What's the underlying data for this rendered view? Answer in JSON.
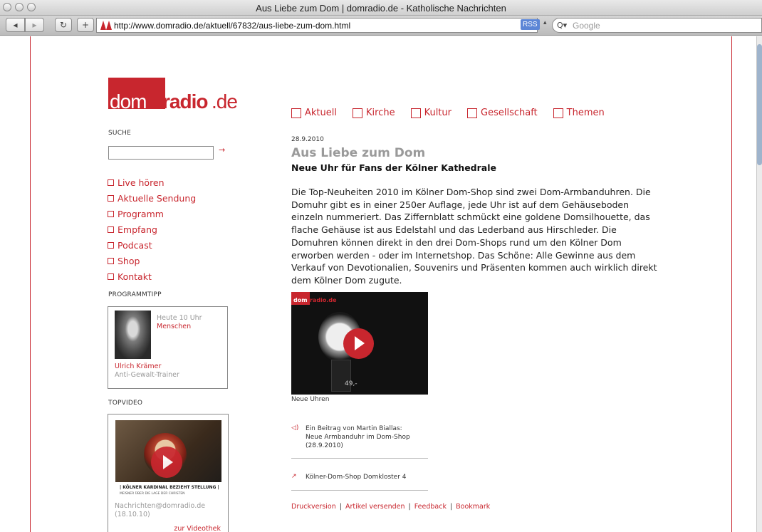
{
  "window": {
    "title": "Aus Liebe zum Dom | domradio.de - Katholische Nachrichten"
  },
  "toolbar": {
    "back_label": "◂",
    "forward_label": "▸",
    "reload_label": "↻",
    "add_label": "+",
    "url": "http://www.domradio.de/aktuell/67832/aus-liebe-zum-dom.html",
    "rss_label": "RSS",
    "search_placeholder": "Google"
  },
  "logo": {
    "part1": "dom",
    "part2": "radio",
    "part3": ".de"
  },
  "topnav": [
    "Aktuell",
    "Kirche",
    "Kultur",
    "Gesellschaft",
    "Themen"
  ],
  "sidebar": {
    "search_label": "SUCHE",
    "search_go": "→",
    "items": [
      "Live hören",
      "Aktuelle Sendung",
      "Programm",
      "Empfang",
      "Podcast",
      "Shop",
      "Kontakt"
    ],
    "programmtipp": {
      "heading": "PROGRAMMTIPP",
      "time": "Heute 10 Uhr",
      "show": "Menschen",
      "name": "Ulrich Krämer",
      "role": "Anti-Gewalt-Trainer"
    },
    "topvideo": {
      "heading": "TOPVIDEO",
      "banner_title": "| KÖLNER KARDINAL BEZIEHT STELLUNG |",
      "banner_sub": "MEISNER ÜBER DIE LAGE DER CHRISTEN",
      "caption1": "Nachrichten@domradio.de",
      "caption2": "(18.10.10)",
      "more_link": "zur Videothek"
    }
  },
  "article": {
    "date": "28.9.2010",
    "title": "Aus Liebe zum Dom",
    "subtitle": "Neue Uhr für Fans der Kölner Kathedrale",
    "body": "Die Top-Neuheiten 2010 im Kölner Dom-Shop sind zwei Dom-Armbanduhren. Die Domuhr gibt es in einer 250er Auflage, jede Uhr ist auf dem Gehäuseboden einzeln nummeriert. Das Ziffernblatt schmückt eine goldene Domsilhouette, das flache Gehäuse ist aus Edelstahl und das Lederband aus Hirschleder. Die Domuhren können direkt in den drei Dom-Shops rund um den Kölner Dom erworben werden - oder im Internetshop. Das Schöne: Alle Gewinne aus dem Verkauf von Devotionalien, Souvenirs und Präsenten kommen auch wirklich direkt dem Kölner Dom zugute.",
    "video": {
      "logo_dom": "dom",
      "logo_radio": "radio.de",
      "price": "49,-",
      "caption": "Neue Uhren"
    },
    "audio_link": "Ein Beitrag von Martin Biallas:\nNeue Armbanduhr im Dom-Shop\n(28.9.2010)",
    "external_link": "Kölner-Dom-Shop Domkloster 4",
    "footer_links": [
      "Druckversion",
      "Artikel versenden",
      "Feedback",
      "Bookmark"
    ]
  }
}
